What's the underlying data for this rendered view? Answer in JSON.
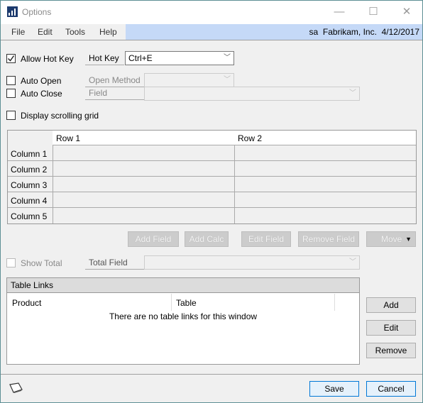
{
  "window": {
    "title": "Options",
    "minimize": "—",
    "maximize": "☐",
    "close": "✕"
  },
  "menu": {
    "items": [
      "File",
      "Edit",
      "Tools",
      "Help"
    ],
    "user": "sa",
    "company": "Fabrikam, Inc.",
    "date": "4/12/2017"
  },
  "hotkey": {
    "allow_label": "Allow Hot Key",
    "allow_checked": true,
    "label": "Hot Key",
    "value": "Ctrl+E"
  },
  "auto_open": {
    "label": "Auto Open",
    "checked": false,
    "method_label": "Open Method",
    "method_value": ""
  },
  "auto_close": {
    "label": "Auto Close",
    "checked": false,
    "field_label": "Field",
    "field_value": ""
  },
  "scrolling_grid": {
    "label": "Display scrolling grid",
    "checked": false
  },
  "grid": {
    "columns": [
      "Row 1",
      "Row 2"
    ],
    "rows": [
      "Column 1",
      "Column 2",
      "Column 3",
      "Column 4",
      "Column 5"
    ]
  },
  "grid_buttons": [
    "Add Field",
    "Add Calc",
    "Edit Field",
    "Remove Field",
    "Move"
  ],
  "total": {
    "label": "Show Total",
    "checked": false,
    "field_label": "Total Field",
    "field_value": ""
  },
  "table_links": {
    "title": "Table Links",
    "columns": [
      "Product",
      "Table"
    ],
    "empty_message": "There are no table links for this window",
    "buttons": [
      "Add",
      "Edit",
      "Remove"
    ]
  },
  "footer": {
    "save": "Save",
    "cancel": "Cancel",
    "note_icon": "note-icon"
  }
}
